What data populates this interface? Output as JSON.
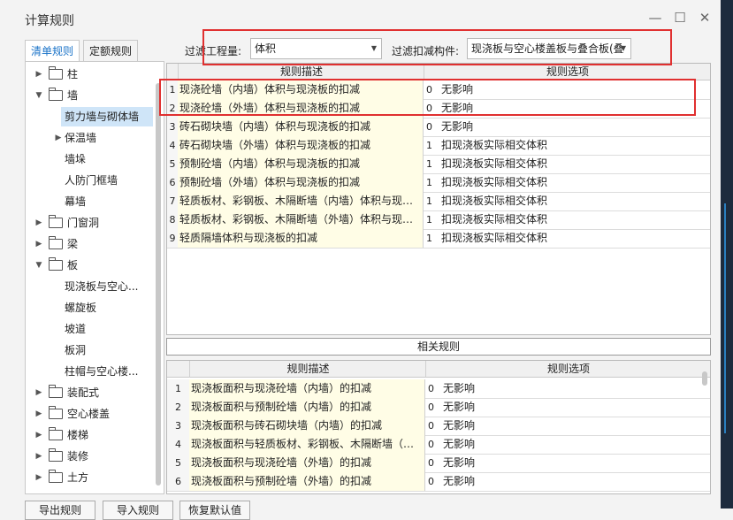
{
  "window": {
    "title": "计算规则"
  },
  "tabs": [
    {
      "label": "清单规则",
      "active": true
    },
    {
      "label": "定额规则",
      "active": false
    }
  ],
  "tree": [
    {
      "label": "柱",
      "level": 0,
      "expand": "collapsed",
      "folder": true
    },
    {
      "label": "墙",
      "level": 0,
      "expand": "expanded",
      "folder": true
    },
    {
      "label": "剪力墙与砌体墙",
      "level": 1,
      "expand": "none",
      "folder": false,
      "selected": true
    },
    {
      "label": "保温墙",
      "level": 1,
      "expand": "collapsed",
      "folder": false
    },
    {
      "label": "墙垛",
      "level": 1,
      "expand": "none",
      "folder": false
    },
    {
      "label": "人防门框墙",
      "level": 1,
      "expand": "none",
      "folder": false
    },
    {
      "label": "幕墙",
      "level": 1,
      "expand": "none",
      "folder": false
    },
    {
      "label": "门窗洞",
      "level": 0,
      "expand": "collapsed",
      "folder": true
    },
    {
      "label": "梁",
      "level": 0,
      "expand": "collapsed",
      "folder": true
    },
    {
      "label": "板",
      "level": 0,
      "expand": "expanded",
      "folder": true
    },
    {
      "label": "现浇板与空心...",
      "level": 1,
      "expand": "none",
      "folder": false
    },
    {
      "label": "螺旋板",
      "level": 1,
      "expand": "none",
      "folder": false
    },
    {
      "label": "坡道",
      "level": 1,
      "expand": "none",
      "folder": false
    },
    {
      "label": "板洞",
      "level": 1,
      "expand": "none",
      "folder": false
    },
    {
      "label": "柱帽与空心楼...",
      "level": 1,
      "expand": "none",
      "folder": false
    },
    {
      "label": "装配式",
      "level": 0,
      "expand": "collapsed",
      "folder": true
    },
    {
      "label": "空心楼盖",
      "level": 0,
      "expand": "collapsed",
      "folder": true
    },
    {
      "label": "楼梯",
      "level": 0,
      "expand": "collapsed",
      "folder": true
    },
    {
      "label": "装修",
      "level": 0,
      "expand": "collapsed",
      "folder": true
    },
    {
      "label": "土方",
      "level": 0,
      "expand": "collapsed",
      "folder": true
    }
  ],
  "filter": {
    "quantity_label": "过滤工程量:",
    "quantity_value": "体积",
    "deduct_label": "过滤扣减构件:",
    "deduct_value": "现浇板与空心楼盖板与叠合板(叠"
  },
  "top_table": {
    "headers": [
      "规则描述",
      "规则选项"
    ],
    "rows": [
      {
        "num": "1",
        "desc": "现浇砼墙（内墙）体积与现浇板的扣减",
        "code": "0",
        "option": "无影响"
      },
      {
        "num": "2",
        "desc": "现浇砼墙（外墙）体积与现浇板的扣减",
        "code": "0",
        "option": "无影响"
      },
      {
        "num": "3",
        "desc": "砖石砌块墙（内墙）体积与现浇板的扣减",
        "code": "0",
        "option": "无影响"
      },
      {
        "num": "4",
        "desc": "砖石砌块墙（外墙）体积与现浇板的扣减",
        "code": "1",
        "option": "扣现浇板实际相交体积"
      },
      {
        "num": "5",
        "desc": "预制砼墙（内墙）体积与现浇板的扣减",
        "code": "1",
        "option": "扣现浇板实际相交体积"
      },
      {
        "num": "6",
        "desc": "预制砼墙（外墙）体积与现浇板的扣减",
        "code": "1",
        "option": "扣现浇板实际相交体积"
      },
      {
        "num": "7",
        "desc": "轻质板材、彩钢板、木隔断墙（内墙）体积与现…",
        "code": "1",
        "option": "扣现浇板实际相交体积"
      },
      {
        "num": "8",
        "desc": "轻质板材、彩钢板、木隔断墙（外墙）体积与现…",
        "code": "1",
        "option": "扣现浇板实际相交体积"
      },
      {
        "num": "9",
        "desc": "轻质隔墙体积与现浇板的扣减",
        "code": "1",
        "option": "扣现浇板实际相交体积"
      }
    ]
  },
  "related": {
    "title": "相关规则",
    "headers": [
      "规则描述",
      "规则选项"
    ],
    "rows": [
      {
        "num": "1",
        "desc": "现浇板面积与现浇砼墙（内墙）的扣减",
        "code": "0",
        "option": "无影响"
      },
      {
        "num": "2",
        "desc": "现浇板面积与预制砼墙（内墙）的扣减",
        "code": "0",
        "option": "无影响"
      },
      {
        "num": "3",
        "desc": "现浇板面积与砖石砌块墙（内墙）的扣减",
        "code": "0",
        "option": "无影响"
      },
      {
        "num": "4",
        "desc": "现浇板面积与轻质板材、彩钢板、木隔断墙（…",
        "code": "0",
        "option": "无影响"
      },
      {
        "num": "5",
        "desc": "现浇板面积与现浇砼墙（外墙）的扣减",
        "code": "0",
        "option": "无影响"
      },
      {
        "num": "6",
        "desc": "现浇板面积与预制砼墙（外墙）的扣减",
        "code": "0",
        "option": "无影响"
      }
    ]
  },
  "bottom_buttons": [
    "导出规则",
    "导入规则",
    "恢复默认值"
  ],
  "colors": {
    "highlight_red": "#e03030",
    "accent_blue": "#1a73c8",
    "desc_cell": "#fffde6",
    "tree_selected": "#cfe5f8"
  }
}
